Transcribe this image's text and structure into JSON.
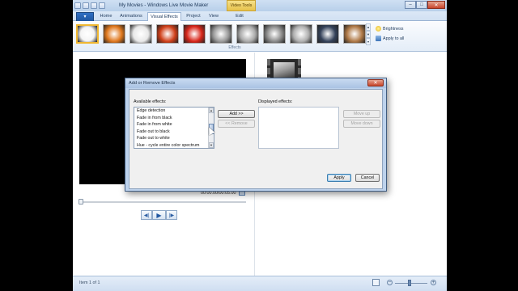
{
  "window": {
    "title": "My Movies - Windows Live Movie Maker",
    "contextual_tab": "Video Tools",
    "controls": {
      "minimize": "–",
      "maximize": "□",
      "close": "✕"
    }
  },
  "ribbon": {
    "file_button_icon": "menu-icon",
    "file_button_glyph": "▾",
    "tabs": [
      {
        "label": "Home"
      },
      {
        "label": "Animations"
      },
      {
        "label": "Visual Effects",
        "active": true
      },
      {
        "label": "Project"
      },
      {
        "label": "View"
      },
      {
        "label": "Edit"
      }
    ],
    "effects_group_label": "Effects",
    "brightness_label": "Brightness",
    "apply_all_label": "Apply to all",
    "gallery_scroll": {
      "up": "▲",
      "down": "▼",
      "more": "▾"
    },
    "effect_thumbnails": [
      {
        "name": "none",
        "color": "#f4f4f4"
      },
      {
        "name": "orange-1",
        "color": "#e0781e"
      },
      {
        "name": "white-blur",
        "color": "#e8e8e8"
      },
      {
        "name": "red-orange",
        "color": "#d0401a"
      },
      {
        "name": "red-yellow",
        "color": "#d8261a"
      },
      {
        "name": "gray-1",
        "color": "#9a9a9a"
      },
      {
        "name": "gray-2",
        "color": "#aaaaaa"
      },
      {
        "name": "gray-3",
        "color": "#8a8a8a"
      },
      {
        "name": "gray-4",
        "color": "#b0b0b0"
      },
      {
        "name": "dark-blue",
        "color": "#34425a"
      },
      {
        "name": "sepia",
        "color": "#b07a48"
      }
    ]
  },
  "preview": {
    "timestamp": "00:00.00/00:05.00",
    "playback": {
      "prev": "◀|",
      "play": "▶",
      "next": "|▶"
    }
  },
  "status": {
    "text": "Item 1 of 1",
    "zoom_out": "–",
    "zoom_in": "+"
  },
  "dialog": {
    "title": "Add or Remove Effects",
    "close": "✕",
    "available_label": "Available effects:",
    "available_effects": [
      "Edge detection",
      "Fade in from black",
      "Fade in from white",
      "Fade out to black",
      "Fade out to white",
      "Hue - cycle entire color spectrum"
    ],
    "list_scroll": {
      "up": "▲",
      "down": "▼"
    },
    "displayed_label": "Displayed effects:",
    "add_button": "Add >>",
    "remove_button": "<< Remove",
    "move_up_button": "Move up",
    "move_down_button": "Move down",
    "apply_button": "Apply",
    "cancel_button": "Cancel"
  }
}
